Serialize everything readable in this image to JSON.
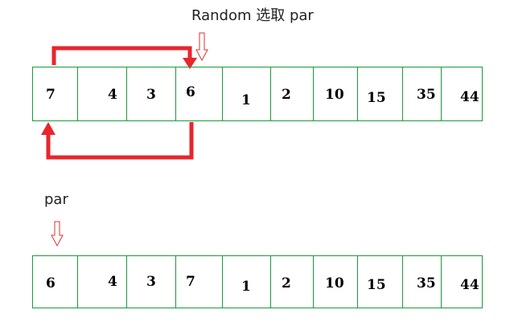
{
  "labels": {
    "top_caption": "Random 选取 par",
    "bottom_caption": "par"
  },
  "arrays": {
    "before": [
      "7",
      "4",
      "3",
      "6",
      "1",
      "2",
      "10",
      "15",
      "35",
      "44"
    ],
    "after": [
      "6",
      "4",
      "3",
      "7",
      "1",
      "2",
      "10",
      "15",
      "35",
      "44"
    ]
  },
  "colors": {
    "cell_border": "#1a9a3a",
    "swap_arrow": "#e8262b",
    "pointer_arrow": "#d9332f"
  }
}
